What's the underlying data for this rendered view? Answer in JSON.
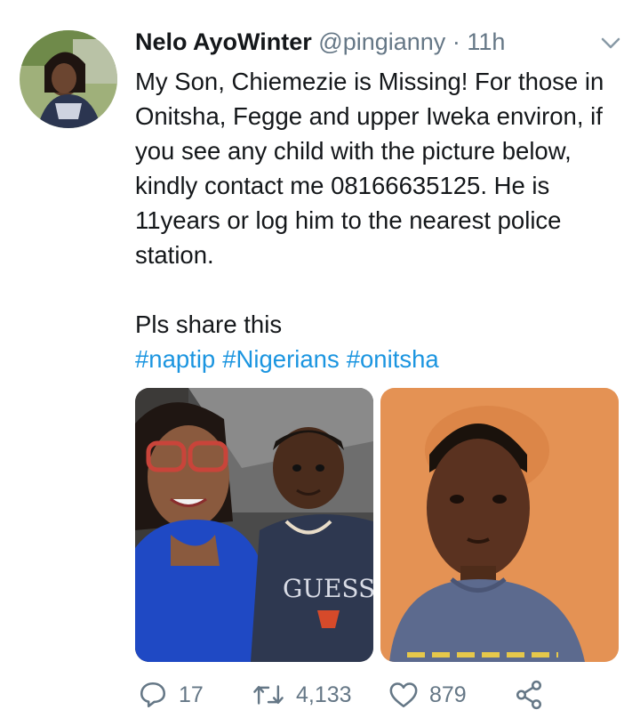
{
  "tweet": {
    "author_name": "Nelo AyoWinter",
    "handle": "@pingianny",
    "separator": "·",
    "time": "11h",
    "text_paragraph_1": "My Son, Chiemezie is Missing! For those in Onitsha, Fegge and upper Iweka environ, if you see any child with the picture below, kindly contact me 08166635125. He is 11years or log him to the nearest police station.",
    "text_paragraph_2": "Pls share this",
    "hashtags": [
      "#naptip",
      "#Nigerians",
      "#onitsha"
    ]
  },
  "actions": {
    "reply_count": "17",
    "retweet_count": "4,133",
    "like_count": "879"
  },
  "media": {
    "photo_left_shirt_text": "GUESS"
  },
  "colors": {
    "link": "#1b95e0",
    "secondary_text": "#657786",
    "primary_text": "#14171a"
  }
}
